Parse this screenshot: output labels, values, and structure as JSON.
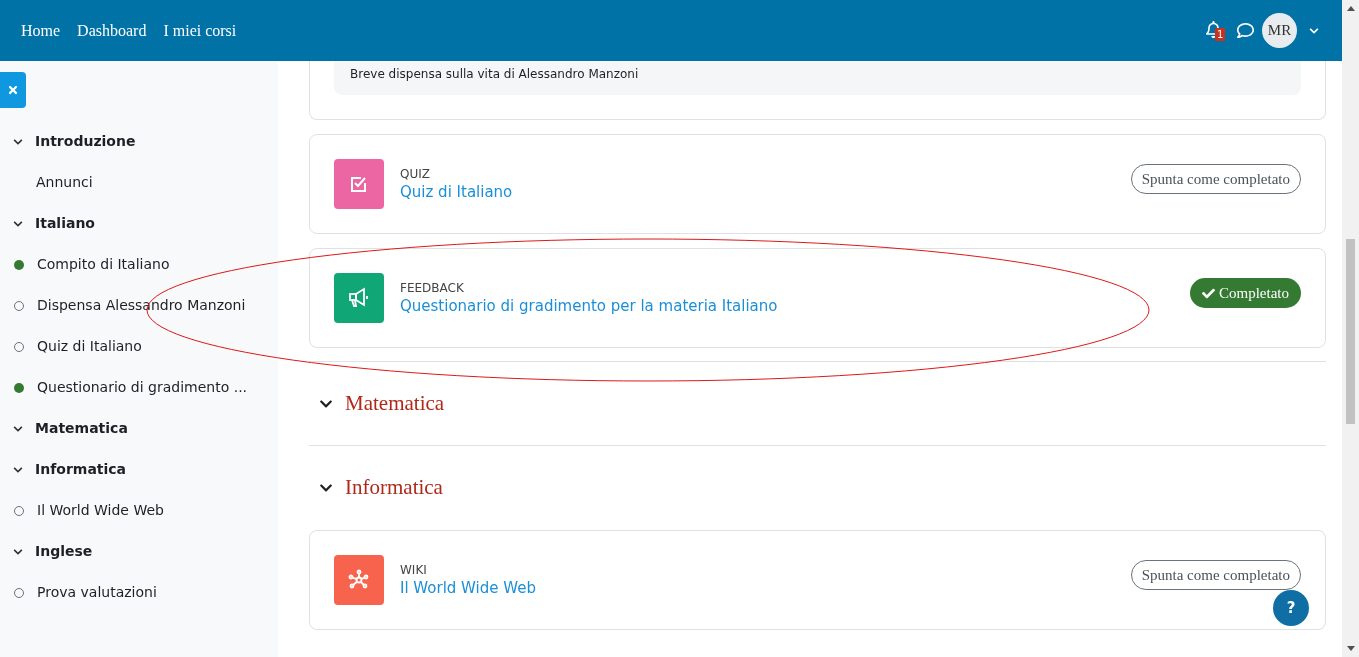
{
  "navbar": {
    "links": [
      "Home",
      "Dashboard",
      "I miei corsi"
    ],
    "notification_count": "1",
    "avatar": "MR"
  },
  "drawer": {
    "sections": [
      {
        "title": "Introduzione",
        "expanded": true,
        "items": [
          {
            "label": "Annunci",
            "kind": "plain"
          }
        ]
      },
      {
        "title": "Italiano",
        "expanded": true,
        "items": [
          {
            "label": "Compito di Italiano",
            "kind": "activity",
            "completed": true
          },
          {
            "label": "Dispensa Alessandro Manzoni",
            "kind": "activity",
            "completed": false
          },
          {
            "label": "Quiz di Italiano",
            "kind": "activity",
            "completed": false
          },
          {
            "label": "Questionario di gradimento ...",
            "kind": "activity",
            "completed": true
          }
        ]
      },
      {
        "title": "Matematica",
        "expanded": true
      },
      {
        "title": "Informatica",
        "expanded": true,
        "items": [
          {
            "label": "Il World Wide Web",
            "kind": "activity",
            "completed": false
          }
        ]
      },
      {
        "title": "Inglese",
        "expanded": true,
        "items": [
          {
            "label": "Prova valutazioni",
            "kind": "activity",
            "completed": false
          }
        ]
      }
    ]
  },
  "content": [
    {
      "kind": "description",
      "text": "Breve dispensa sulla vita di Alessandro Manzoni"
    },
    {
      "kind": "quiz",
      "type": "QUIZ",
      "title": "Quiz di Italiano",
      "completion": {
        "done": false,
        "label": "Spunta come completato"
      }
    },
    {
      "kind": "feedback",
      "type": "FEEDBACK",
      "title": "Questionario di gradimento per la materia Italiano",
      "completion": {
        "done": true,
        "label": "Completato"
      },
      "circled": true
    },
    {
      "kind": "section",
      "title": "Matematica",
      "expanded": true
    },
    {
      "kind": "section",
      "title": "Informatica",
      "expanded": true
    },
    {
      "kind": "wiki",
      "type": "WIKI",
      "title": "Il World Wide Web",
      "completion": {
        "done": false,
        "label": "Spunta come completato"
      }
    }
  ],
  "help": "?"
}
